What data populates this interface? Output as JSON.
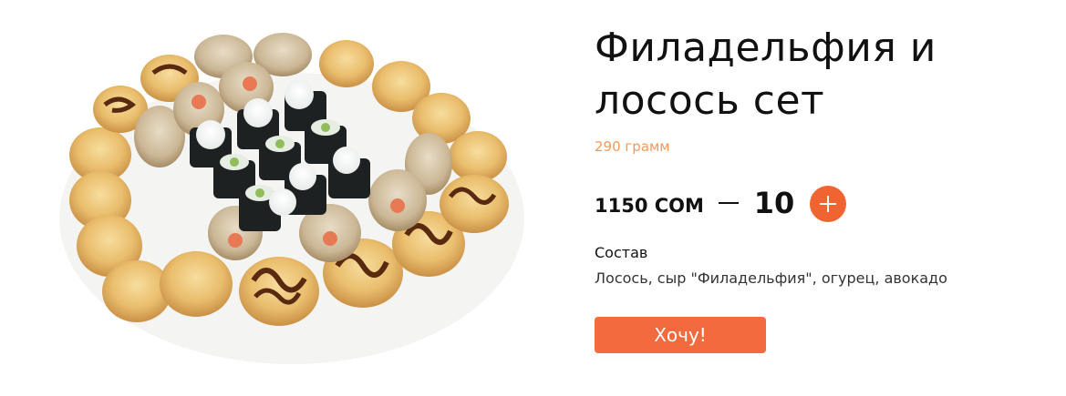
{
  "product": {
    "title": "Филадельфия и лосось сет",
    "weight": "290 грамм",
    "price": "1150 СОМ",
    "quantity": "10",
    "composition_title": "Состав",
    "composition": "Лосось, сыр \"Филадельфия\", огурец, авокадо",
    "buy_label": "Хочу!"
  },
  "icons": {
    "minus": "minus-icon",
    "plus": "plus-icon"
  },
  "colors": {
    "accent": "#f26a3d",
    "weight_text": "#f39a5b",
    "text": "#111111"
  }
}
